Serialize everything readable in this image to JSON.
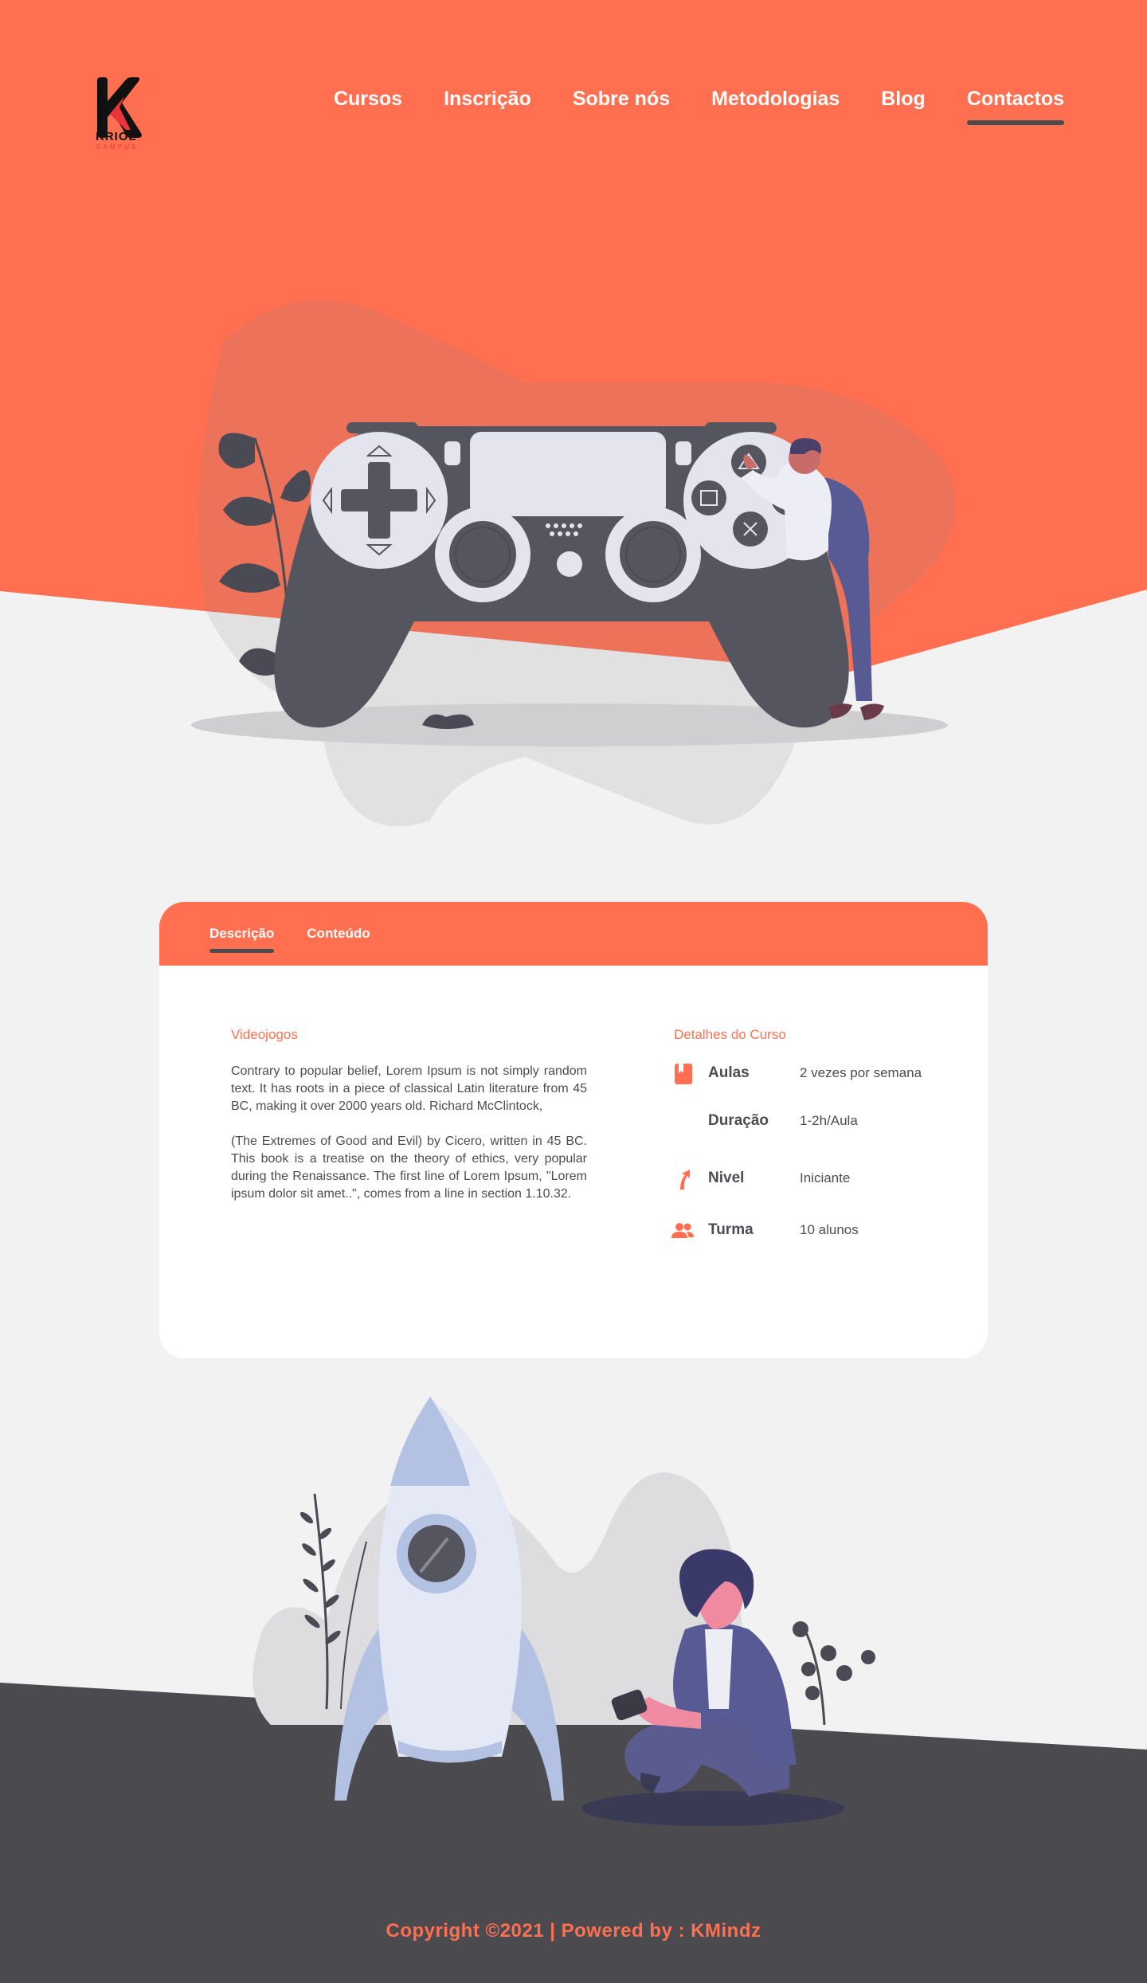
{
  "brand": {
    "name": "KRIOL",
    "subtitle": "CAMPUS",
    "color_primary": "#ff6f50",
    "color_dark": "#4a4a4f"
  },
  "nav": {
    "items": [
      {
        "label": "Cursos"
      },
      {
        "label": "Inscrição"
      },
      {
        "label": "Sobre nós"
      },
      {
        "label": "Metodologias"
      },
      {
        "label": "Blog"
      },
      {
        "label": "Contactos"
      }
    ],
    "active": "Contactos"
  },
  "card": {
    "tabs": [
      {
        "label": "Descrição"
      },
      {
        "label": "Conteúdo"
      }
    ],
    "active_tab": "Descrição",
    "description": {
      "title": "Videojogos",
      "paragraphs": [
        "Contrary to popular belief, Lorem Ipsum is not simply random text. It has roots in a piece of classical Latin literature from 45 BC, making it over 2000 years old. Richard McClintock,",
        "(The Extremes of Good and Evil) by Cicero, written in 45 BC. This book is a treatise on the theory of ethics, very popular during the Renaissance. The first line of Lorem Ipsum, \"Lorem ipsum dolor sit amet..\", comes from a line in section 1.10.32."
      ]
    },
    "details": {
      "title": "Detalhes do  Curso",
      "rows": [
        {
          "icon": "book-icon",
          "label": "Aulas",
          "value": "2 vezes por semana"
        },
        {
          "icon": "",
          "label": "Duração",
          "value": "1-2h/Aula"
        },
        {
          "icon": "level-arrow-icon",
          "label": "Nivel",
          "value": "Iniciante"
        },
        {
          "icon": "people-icon",
          "label": "Turma",
          "value": "10 alunos"
        }
      ]
    }
  },
  "footer": {
    "text": "Copyright ©2021 | Powered by : KMindz"
  }
}
